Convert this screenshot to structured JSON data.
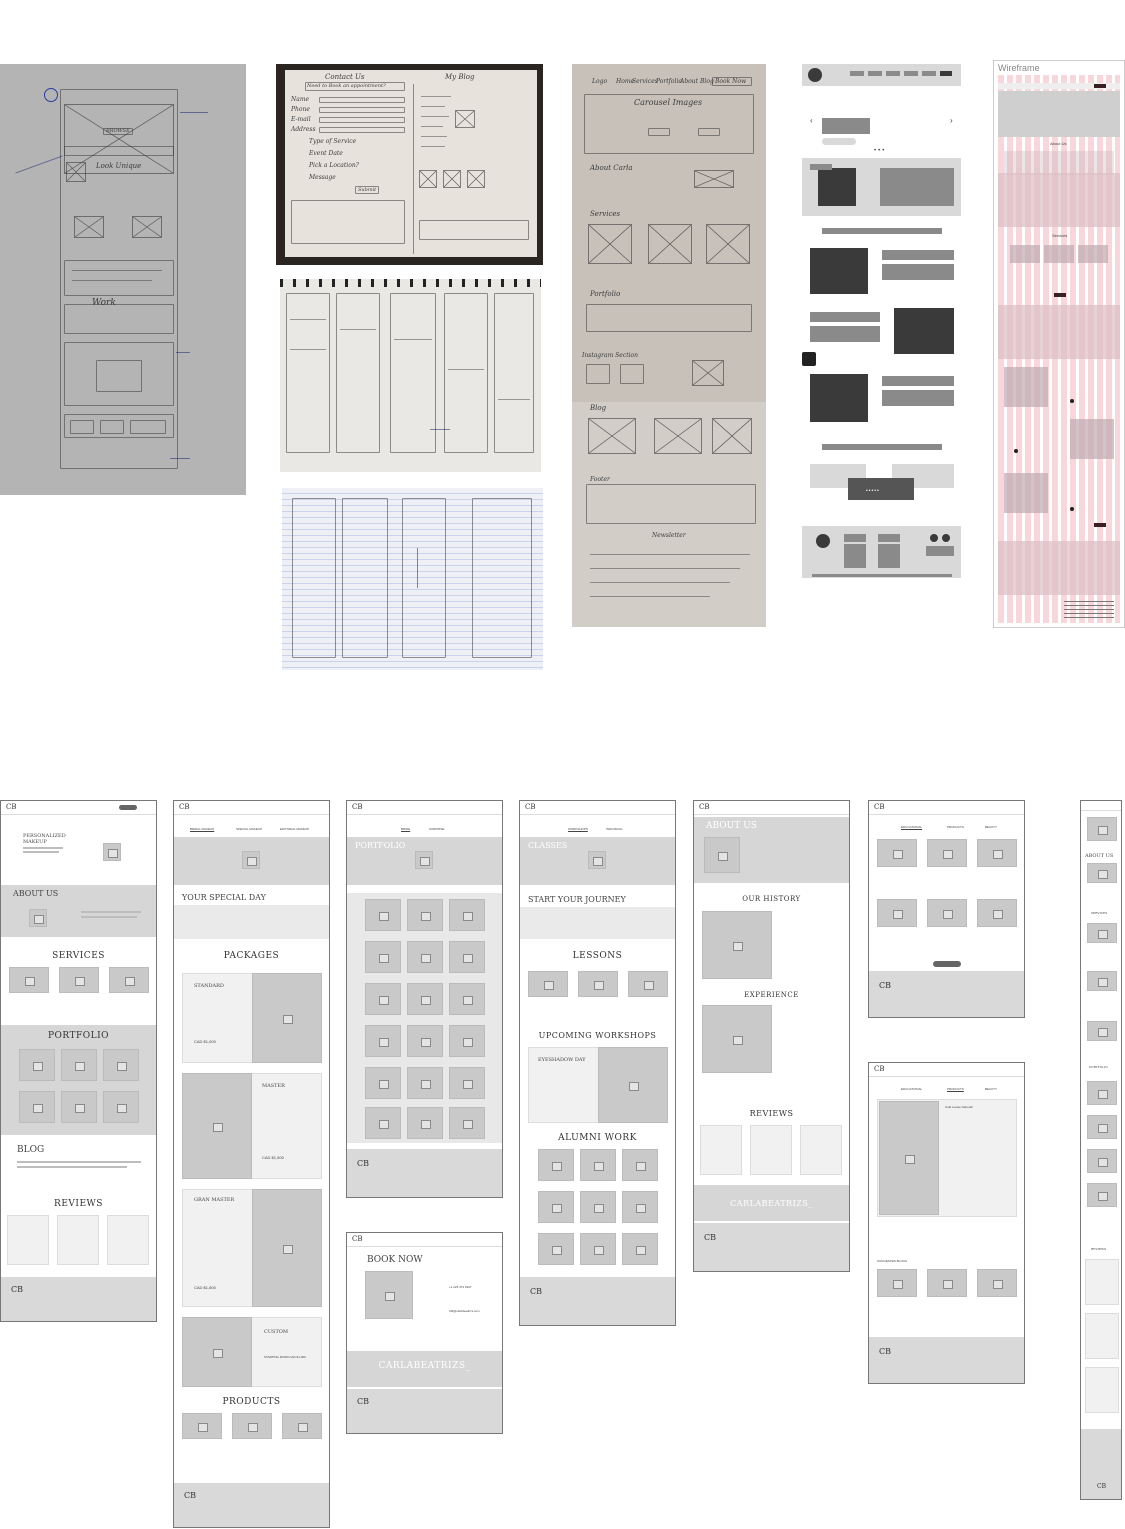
{
  "sketches": {
    "sketch1": {
      "labels": [
        "BROWSE",
        "Work",
        "Look Unique"
      ]
    },
    "sketch2": {
      "labels": [
        "Contact Us",
        "My Blog",
        "Need to Book an appointment?",
        "Submit",
        "Name",
        "Phone",
        "E-mail",
        "Address",
        "Type of Service",
        "Event Date",
        "Pick a Location?",
        "Message"
      ]
    },
    "sketch5": {
      "labels": [
        "Logo",
        "Home",
        "Services",
        "Portfolio",
        "About",
        "Blog",
        "Book Now",
        "Carousel Images",
        "About Carla",
        "Services",
        "Portfolio",
        "Instagram Section",
        "Blog",
        "Footer",
        "Newsletter"
      ]
    }
  },
  "lowfi": {
    "label": "Wireframe"
  },
  "hifi": {
    "label": "Wireframe",
    "texts": [
      "About Us",
      "Services"
    ]
  },
  "screens": {
    "home": {
      "hero": "PERSONALIZED MAKEUP",
      "about": "ABOUT US",
      "services": "SERVICES",
      "portfolio": "PORTFOLIO",
      "blog": "BLOG",
      "reviews": "REVIEWS",
      "logo": "CB"
    },
    "services": {
      "tabs": [
        "BRIDAL MAKEUP",
        "SPECIAL MAKEUP",
        "EDITORIAL MAKEUP"
      ],
      "title": "YOUR SPECIAL DAY",
      "packages": "PACKAGES",
      "standard": "STANDARD",
      "standard_price": "CAD $1,000",
      "master": "MASTER",
      "master_price": "CAD $1,500",
      "gran": "GRAN MASTER",
      "gran_price": "CAD $1,800",
      "custom": "CUSTOM",
      "custom_price": "STARTING FROM CAD $1,000",
      "products": "PRODUCTS"
    },
    "portfolio": {
      "tabs": [
        "BRIDE",
        "SURPRISE"
      ],
      "title": "PORTFOLIO"
    },
    "book": {
      "title": "BOOK NOW",
      "phone": "+1 226 473 3947",
      "email": "CB@carlabeatrizs.com",
      "insta": "CARLABEATRIZS_"
    },
    "classes": {
      "tabs": [
        "WORKSHOPS",
        "INDIVIDUAL"
      ],
      "title": "CLASSES",
      "journey": "START YOUR JOURNEY",
      "lessons": "LESSONS",
      "workshops": "UPCOMING WORKSHOPS",
      "eyeshadow": "EYESHADOW DAY",
      "alumni": "ALUMNI WORK"
    },
    "about": {
      "title": "ABOUT US",
      "history": "OUR HISTORY",
      "experience": "EXPERIENCE",
      "reviews": "REVIEWS",
      "insta": "CARLABEATRIZS_"
    },
    "blog": {
      "tabs": [
        "EDUCATIONAL",
        "PRODUCTS",
        "BEAUTY"
      ]
    },
    "blogpost": {
      "tabs": [
        "EDUCATIONAL",
        "PRODUCTS",
        "BEAUTY"
      ],
      "post_title": "Cold Louise Nebuuth",
      "suggested": "SUGGESTED BLOGS"
    },
    "mobile": {
      "about": "ABOUT US",
      "services": "SERVICES",
      "portfolio": "PORTFOLIO",
      "reviews": "REVIEWS"
    }
  }
}
